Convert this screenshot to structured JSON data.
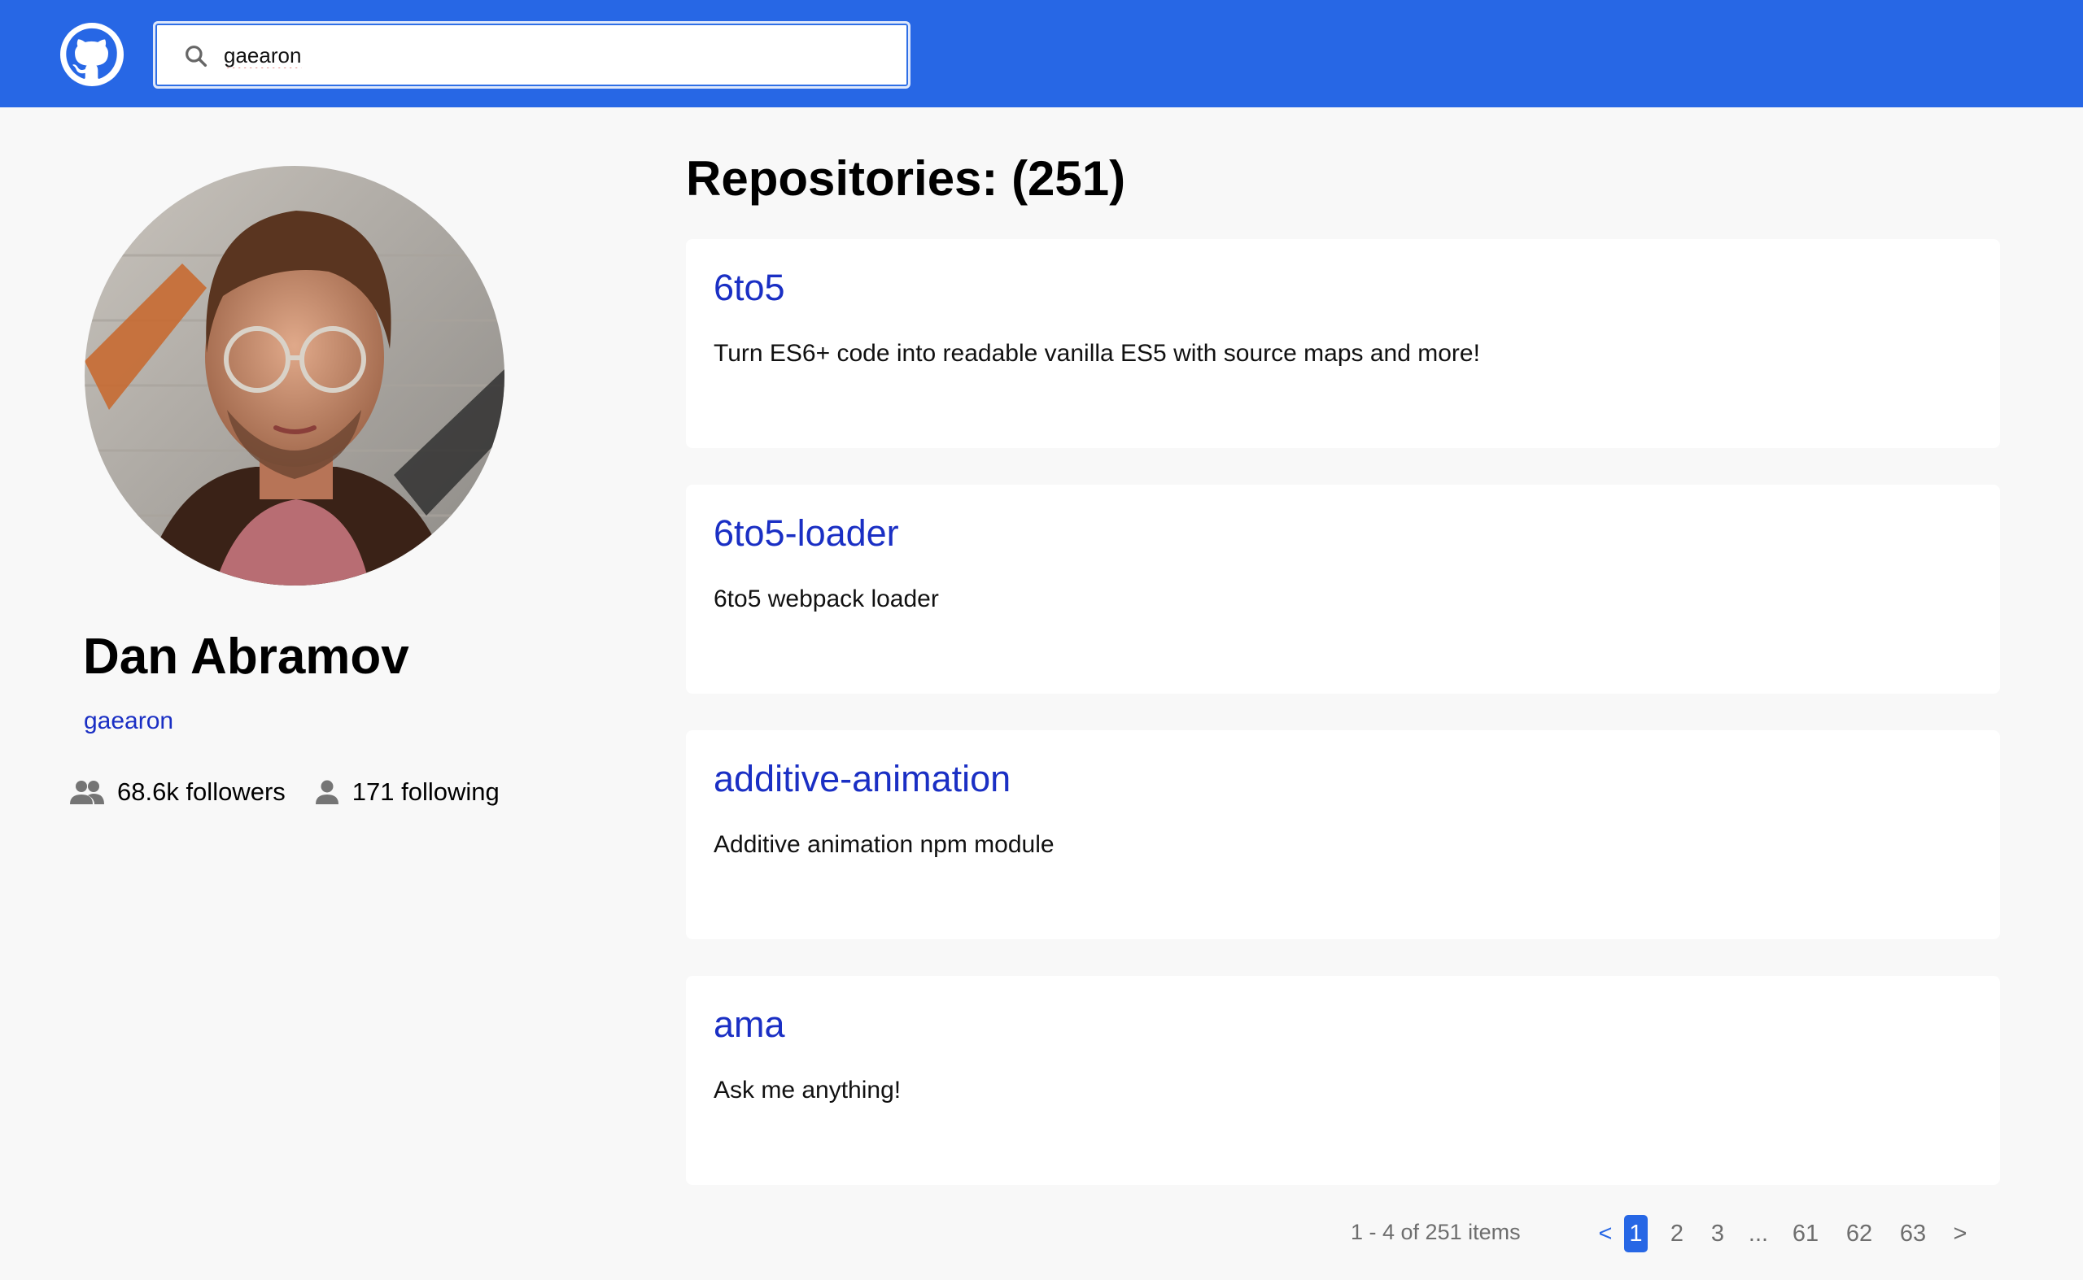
{
  "header": {
    "logo_icon": "github-octocat-icon",
    "search": {
      "icon": "search-icon",
      "value": "gaearon",
      "placeholder": ""
    },
    "colors": {
      "bar": "#2767e5"
    }
  },
  "profile": {
    "avatar_icon": "user-avatar-photo",
    "name": "Dan Abramov",
    "login": "gaearon",
    "followers": {
      "icon": "people-icon",
      "label": "68.6k followers"
    },
    "following": {
      "icon": "person-icon",
      "label": "171 following"
    }
  },
  "repos": {
    "heading": "Repositories: (251)",
    "items": [
      {
        "name": "6to5",
        "description": "Turn ES6+ code into readable vanilla ES5 with source maps and more!"
      },
      {
        "name": "6to5-loader",
        "description": "6to5 webpack loader"
      },
      {
        "name": "additive-animation",
        "description": "Additive animation npm module"
      },
      {
        "name": "ama",
        "description": "Ask me anything!"
      }
    ]
  },
  "pagination": {
    "summary": "1 - 4 of 251 items",
    "prev": "<",
    "current": "1",
    "pages": [
      "2",
      "3"
    ],
    "ellipsis": "...",
    "last_pages": [
      "61",
      "62",
      "63"
    ],
    "next": ">"
  }
}
